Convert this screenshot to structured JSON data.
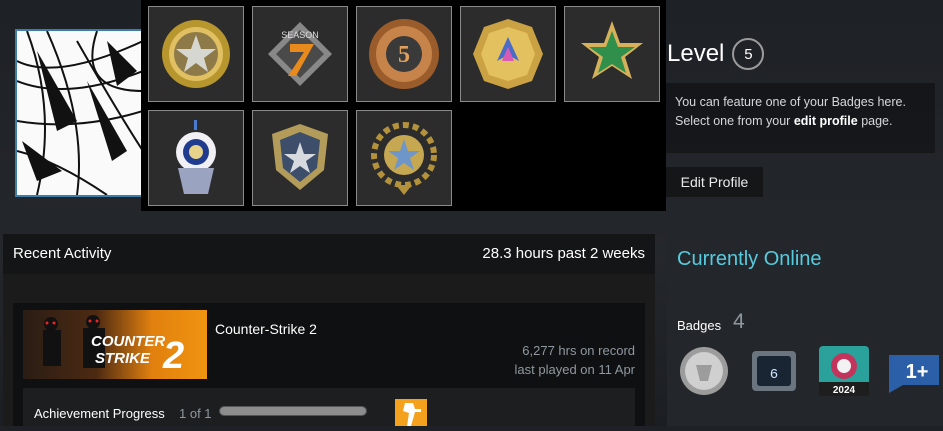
{
  "level": {
    "label": "Level",
    "value": "5"
  },
  "feature_note": {
    "line1": "You can feature one of your Badges here.",
    "line2_pre": "Select one from your ",
    "line2_link": "edit profile",
    "line2_post": " page."
  },
  "edit_profile_label": "Edit Profile",
  "picker": {
    "badges": [
      {
        "name": "gold-star-coin-icon"
      },
      {
        "name": "season-7-icon"
      },
      {
        "name": "five-year-veteran-coin-icon"
      },
      {
        "name": "2012-2023-coin-icon"
      },
      {
        "name": "green-star-icon"
      },
      {
        "name": "cupcake-icon"
      },
      {
        "name": "silver-star-shield-icon"
      },
      {
        "name": "blue-star-laurel-icon"
      }
    ]
  },
  "recent": {
    "title": "Recent Activity",
    "hours": "28.3 hours past 2 weeks",
    "game": {
      "name": "Counter-Strike 2",
      "art_text_1": "COUNTER",
      "art_text_2": "STRIKE",
      "art_number": "2",
      "hrs_on_record": "6,277 hrs on record",
      "last_played": "last played on 11 Apr",
      "achievement_label": "Achievement Progress",
      "achievement_count": "1 of 1",
      "achievement_progress": 1.0
    }
  },
  "online": {
    "status": "Currently Online",
    "badges_label": "Badges",
    "badges_count": "4",
    "mini_badges": [
      {
        "name": "silver-coin-badge-icon"
      },
      {
        "name": "six-year-badge-icon",
        "text": "6"
      },
      {
        "name": "steam-2024-badge-icon",
        "text": "2024"
      },
      {
        "name": "one-plus-badge-icon",
        "text": "1+"
      }
    ]
  },
  "colors": {
    "accent": "#57cbde",
    "avatar_border": "#3d7ea8"
  }
}
